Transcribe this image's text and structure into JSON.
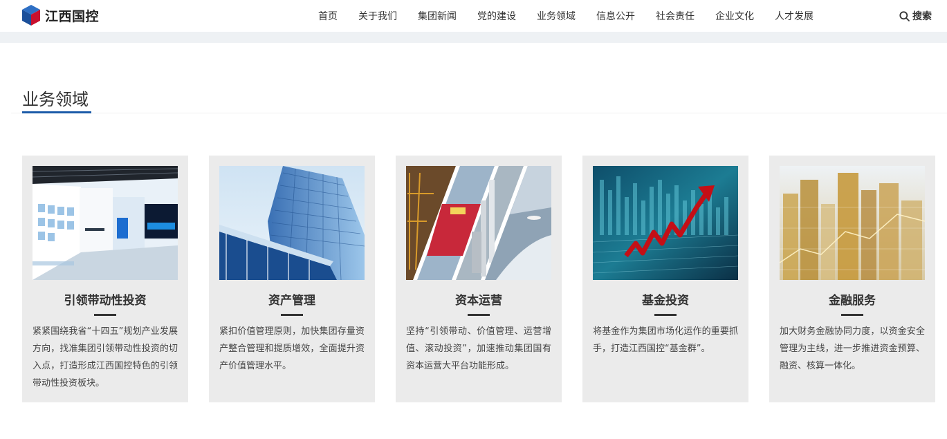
{
  "header": {
    "logo_text": "江西国控",
    "nav": [
      "首页",
      "关于我们",
      "集团新闻",
      "党的建设",
      "业务领域",
      "信息公开",
      "社会责任",
      "企业文化",
      "人才发展"
    ],
    "search_label": "搜索"
  },
  "section": {
    "title": "业务领域"
  },
  "cards": [
    {
      "title": "引领带动性投资",
      "desc": "紧紧围绕我省“十四五”规划产业发展方向，找准集团引领带动性投资的切入点，打造形成江西国控特色的引领带动性投资板块。"
    },
    {
      "title": "资产管理",
      "desc": "紧扣价值管理原则，加快集团存量资产整合管理和提质增效，全面提升资产价值管理水平。"
    },
    {
      "title": "资本运营",
      "desc": "坚持“引领带动、价值管理、运营增值、滚动投资”，加速推动集团国有资本运营大平台功能形成。"
    },
    {
      "title": "基金投资",
      "desc": "将基金作为集团市场化运作的重要抓手，打造江西国控“基金群”。"
    },
    {
      "title": "金融服务",
      "desc": "加大财务金融协同力度，以资金安全管理为主线，进一步推进资金预算、融资、核算一体化。"
    }
  ],
  "colors": {
    "accent": "#1b5aa8",
    "card_bg": "#ebebeb",
    "logo_red": "#c8102e"
  }
}
